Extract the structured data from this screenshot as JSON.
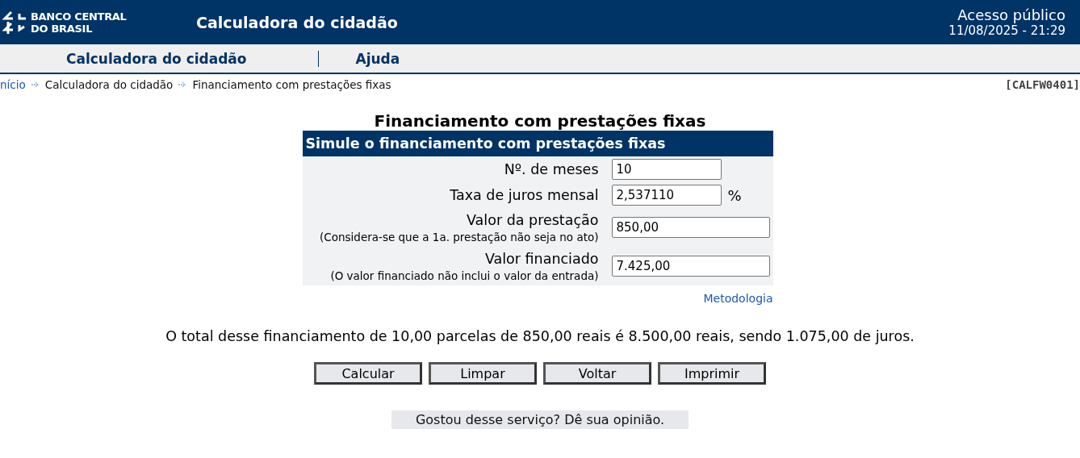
{
  "header": {
    "logo_lines": [
      "BANCO CENTRAL",
      "DO BRASIL"
    ],
    "title": "Calculadora do cidadão",
    "access": "Acesso público",
    "datetime": "11/08/2025 - 21:29"
  },
  "menu": [
    {
      "label": "Calculadora do cidadão"
    },
    {
      "label": "Ajuda"
    }
  ],
  "breadcrumb": [
    {
      "label": "nício",
      "link": true
    },
    {
      "label": "Calculadora do cidadão",
      "link": false
    },
    {
      "label": "Financiamento com prestações fixas",
      "link": false
    }
  ],
  "screen_code": "[CALFW0401]",
  "page_title": "Financiamento com prestações fixas",
  "form": {
    "heading": "Simule o financiamento com prestações fixas",
    "fields": [
      {
        "label": "Nº. de meses",
        "value": "10",
        "kind": "short"
      },
      {
        "label": "Taxa de juros mensal",
        "value": "2,537110",
        "kind": "short",
        "unit": "%"
      },
      {
        "label": "Valor da prestação",
        "note": "(Considera-se que a 1a. prestação não seja no ato)",
        "value": "850,00",
        "kind": "long"
      },
      {
        "label": "Valor financiado",
        "note": "(O valor financiado não inclui o valor da entrada)",
        "value": "7.425,00",
        "kind": "long"
      }
    ],
    "link": "Metodologia"
  },
  "result": "O total desse financiamento de 10,00 parcelas de 850,00 reais é 8.500,00 reais, sendo 1.075,00 de juros.",
  "buttons": [
    "Calcular",
    "Limpar",
    "Voltar",
    "Imprimir"
  ],
  "feedback": "Gostou desse serviço? Dê sua opinião."
}
